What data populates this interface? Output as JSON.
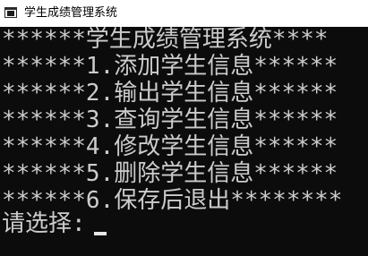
{
  "window": {
    "title": "学生成绩管理系统",
    "icon": "console-window-icon"
  },
  "console": {
    "lines": [
      "******学生成绩管理系统****",
      "******1.添加学生信息******",
      "******2.输出学生信息******",
      "******3.查询学生信息******",
      "******4.修改学生信息******",
      "******5.删除学生信息******",
      "******6.保存后退出********"
    ],
    "prompt": "请选择:"
  },
  "colors": {
    "console_bg": "#0c0c0c",
    "console_text": "#cccccc",
    "titlebar_bg": "#ffffff"
  }
}
